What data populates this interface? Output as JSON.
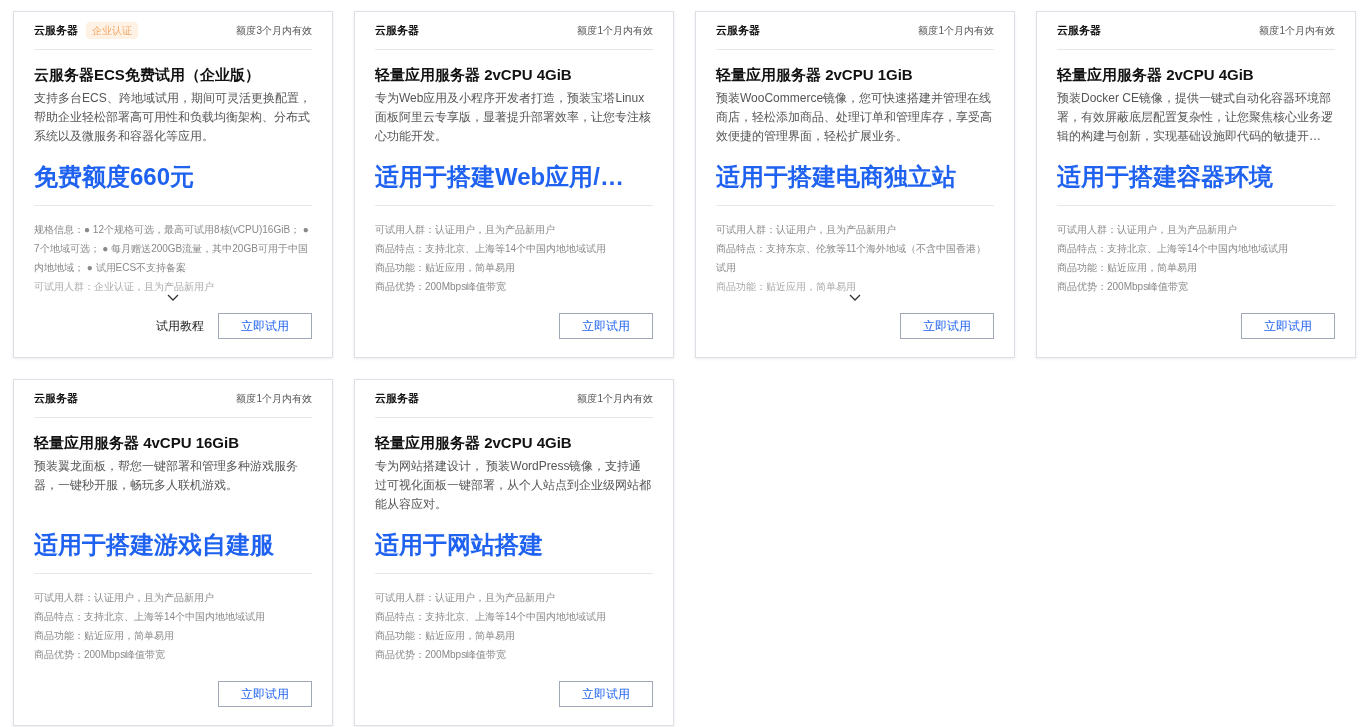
{
  "cards": [
    {
      "category": "云服务器",
      "badge": "企业认证",
      "validity": "额度3个月内有效",
      "title": "云服务器ECS免费试用（企业版）",
      "description": "支持多台ECS、跨地域试用，期间可灵活更换配置，帮助企业轻松部署高可用性和负载均衡架构、分布式系统以及微服务和容器化等应用。",
      "headline": "免费额度660元",
      "details": [
        "规格信息：● 12个规格可选，最高可试用8核(vCPU)16GiB； ● 7个地域可选； ● 每月赠送200GB流量，其中20GB可用于中国内地地域； ● 试用ECS不支持备案",
        "可试用人群：企业认证，且为产品新用户"
      ],
      "collapsed": true,
      "tutorial_link": "试用教程",
      "button": "立即试用"
    },
    {
      "category": "云服务器",
      "validity": "额度1个月内有效",
      "title": "轻量应用服务器 2vCPU 4GiB",
      "description": "专为Web应用及小程序开发者打造，预装宝塔Linux面板阿里云专享版，显著提升部署效率，让您专注核心功能开发。",
      "headline": "适用于搭建Web应用/…",
      "details": [
        "可试用人群：认证用户，且为产品新用户",
        "商品特点：支持北京、上海等14个中国内地地域试用",
        "商品功能：贴近应用，简单易用",
        "商品优势：200Mbps峰值带宽"
      ],
      "collapsed": false,
      "button": "立即试用"
    },
    {
      "category": "云服务器",
      "validity": "额度1个月内有效",
      "title": "轻量应用服务器 2vCPU 1GiB",
      "description": "预装WooCommerce镜像，您可快速搭建并管理在线商店，轻松添加商品、处理订单和管理库存，享受高效便捷的管理界面，轻松扩展业务。",
      "headline": "适用于搭建电商独立站",
      "details": [
        "可试用人群：认证用户，且为产品新用户",
        "商品特点：支持东京、伦敦等11个海外地域（不含中国香港）试用",
        "商品功能：贴近应用，简单易用"
      ],
      "collapsed": true,
      "button": "立即试用"
    },
    {
      "category": "云服务器",
      "validity": "额度1个月内有效",
      "title": "轻量应用服务器 2vCPU 4GiB",
      "description": "预装Docker CE镜像，提供一键式自动化容器环境部署，有效屏蔽底层配置复杂性，让您聚焦核心业务逻辑的构建与创新，实现基础设施即代码的敏捷开…",
      "headline": "适用于搭建容器环境",
      "details": [
        "可试用人群：认证用户，且为产品新用户",
        "商品特点：支持北京、上海等14个中国内地地域试用",
        "商品功能：贴近应用，简单易用",
        "商品优势：200Mbps峰值带宽"
      ],
      "collapsed": false,
      "button": "立即试用"
    },
    {
      "category": "云服务器",
      "validity": "额度1个月内有效",
      "title": "轻量应用服务器 4vCPU 16GiB",
      "description": "预装翼龙面板，帮您一键部署和管理多种游戏服务器，一键秒开服，畅玩多人联机游戏。",
      "headline": "适用于搭建游戏自建服",
      "details": [
        "可试用人群：认证用户，且为产品新用户",
        "商品特点：支持北京、上海等14个中国内地地域试用",
        "商品功能：贴近应用，简单易用",
        "商品优势：200Mbps峰值带宽"
      ],
      "collapsed": false,
      "button": "立即试用"
    },
    {
      "category": "云服务器",
      "validity": "额度1个月内有效",
      "title": "轻量应用服务器 2vCPU 4GiB",
      "description": "专为网站搭建设计， 预装WordPress镜像，支持通过可视化面板一键部署，从个人站点到企业级网站都能从容应对。",
      "headline": "适用于网站搭建",
      "details": [
        "可试用人群：认证用户，且为产品新用户",
        "商品特点：支持北京、上海等14个中国内地地域试用",
        "商品功能：贴近应用，简单易用",
        "商品优势：200Mbps峰值带宽"
      ],
      "collapsed": false,
      "button": "立即试用"
    }
  ]
}
